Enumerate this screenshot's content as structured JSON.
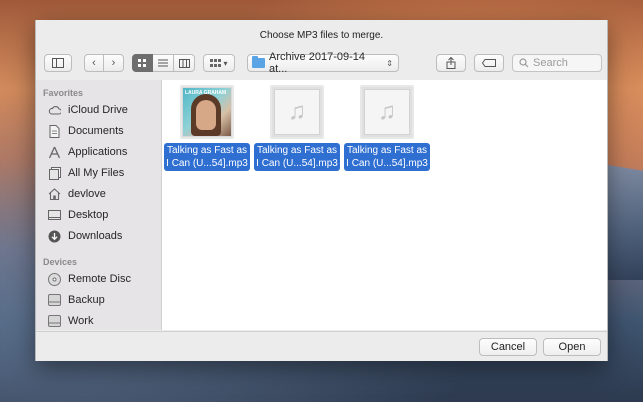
{
  "dialog": {
    "title": "Choose MP3 files to merge."
  },
  "toolbar": {
    "path": "Archive 2017-09-14 at...",
    "search_placeholder": "Search"
  },
  "sidebar": {
    "favorites_header": "Favorites",
    "favorites": [
      {
        "label": "iCloud Drive",
        "icon": "cloud-icon"
      },
      {
        "label": "Documents",
        "icon": "document-icon"
      },
      {
        "label": "Applications",
        "icon": "applications-icon"
      },
      {
        "label": "All My Files",
        "icon": "all-files-icon"
      },
      {
        "label": "devlove",
        "icon": "home-icon"
      },
      {
        "label": "Desktop",
        "icon": "desktop-icon"
      },
      {
        "label": "Downloads",
        "icon": "download-icon"
      }
    ],
    "devices_header": "Devices",
    "devices": [
      {
        "label": "Remote Disc",
        "icon": "disc-icon"
      },
      {
        "label": "Backup",
        "icon": "drive-icon"
      },
      {
        "label": "Work",
        "icon": "drive-icon"
      }
    ]
  },
  "files": [
    {
      "line1": "Talking as Fast as",
      "line2": "I Can (U...54].mp3",
      "thumb": "album-cover",
      "cover_text": "LAURA GRAHAM"
    },
    {
      "line1": "Talking as Fast as",
      "line2": "I Can (U...54].mp3",
      "thumb": "music-file-icon"
    },
    {
      "line1": "Talking as Fast as",
      "line2": "I Can (U...54].mp3",
      "thumb": "music-file-icon"
    }
  ],
  "footer": {
    "cancel_label": "Cancel",
    "open_label": "Open"
  },
  "colors": {
    "selection": "#2f6fd1",
    "folder": "#5aa4e6"
  }
}
